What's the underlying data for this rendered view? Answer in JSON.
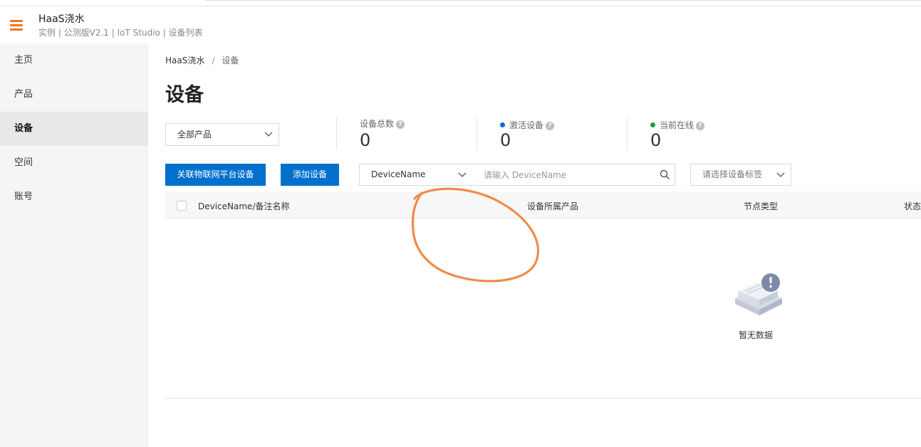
{
  "header": {
    "title": "HaaS浇水",
    "subtitle": "实例 | 公测版V2.1 | IoT Studio | 设备列表"
  },
  "sidebar": {
    "items": [
      {
        "label": "主页"
      },
      {
        "label": "产品"
      },
      {
        "label": "设备"
      },
      {
        "label": "空间"
      },
      {
        "label": "账号"
      }
    ],
    "active_index": 2
  },
  "breadcrumb": {
    "root": "HaaS浇水",
    "separator": "/",
    "current": "设备"
  },
  "page_title": "设备",
  "product_filter": {
    "value": "全部产品"
  },
  "stats": [
    {
      "label": "设备总数",
      "value": "0",
      "dot_color": ""
    },
    {
      "label": "激活设备",
      "value": "0",
      "dot_color": "#0070cc"
    },
    {
      "label": "当前在线",
      "value": "0",
      "dot_color": "#1e9e3e"
    }
  ],
  "toolbar": {
    "link_button": "关联物联网平台设备",
    "add_button": "添加设备",
    "field_select": "DeviceName",
    "search_placeholder": "请输入 DeviceName",
    "tag_select": "请选择设备标签"
  },
  "table": {
    "columns": [
      "DeviceName/备注名称",
      "设备所属产品",
      "节点类型",
      "状态"
    ],
    "rows": [],
    "empty_text": "暂无数据"
  },
  "colors": {
    "accent": "#0070cc",
    "menu_icon": "#f0741e",
    "annotation": "#f08a4b"
  },
  "icons": {
    "menu": "hamburger-icon",
    "search": "search-icon",
    "help": "question-circle-icon",
    "empty": "empty-box-icon"
  }
}
